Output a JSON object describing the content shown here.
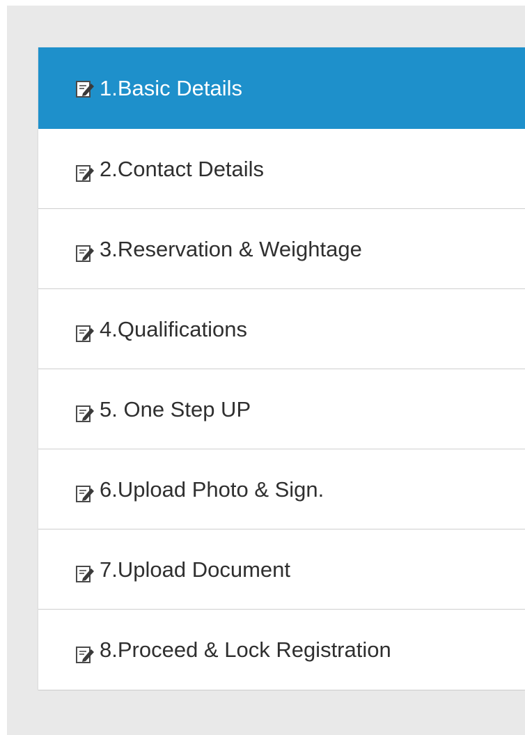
{
  "menu": {
    "items": [
      {
        "label": "1.Basic Details",
        "icon": "edit-icon",
        "active": true
      },
      {
        "label": "2.Contact Details",
        "icon": "edit-icon",
        "active": false
      },
      {
        "label": "3.Reservation & Weightage",
        "icon": "edit-icon",
        "active": false
      },
      {
        "label": "4.Qualifications",
        "icon": "edit-icon",
        "active": false
      },
      {
        "label": "5. One Step UP",
        "icon": "edit-icon",
        "active": false
      },
      {
        "label": "6.Upload Photo & Sign.",
        "icon": "edit-icon",
        "active": false
      },
      {
        "label": "7.Upload Document",
        "icon": "edit-icon",
        "active": false
      },
      {
        "label": "8.Proceed & Lock Registration",
        "icon": "edit-icon",
        "active": false
      }
    ]
  },
  "colors": {
    "active_bg": "#1e90cb",
    "panel_bg": "#e9e9e9",
    "text": "#2f2f2f"
  }
}
